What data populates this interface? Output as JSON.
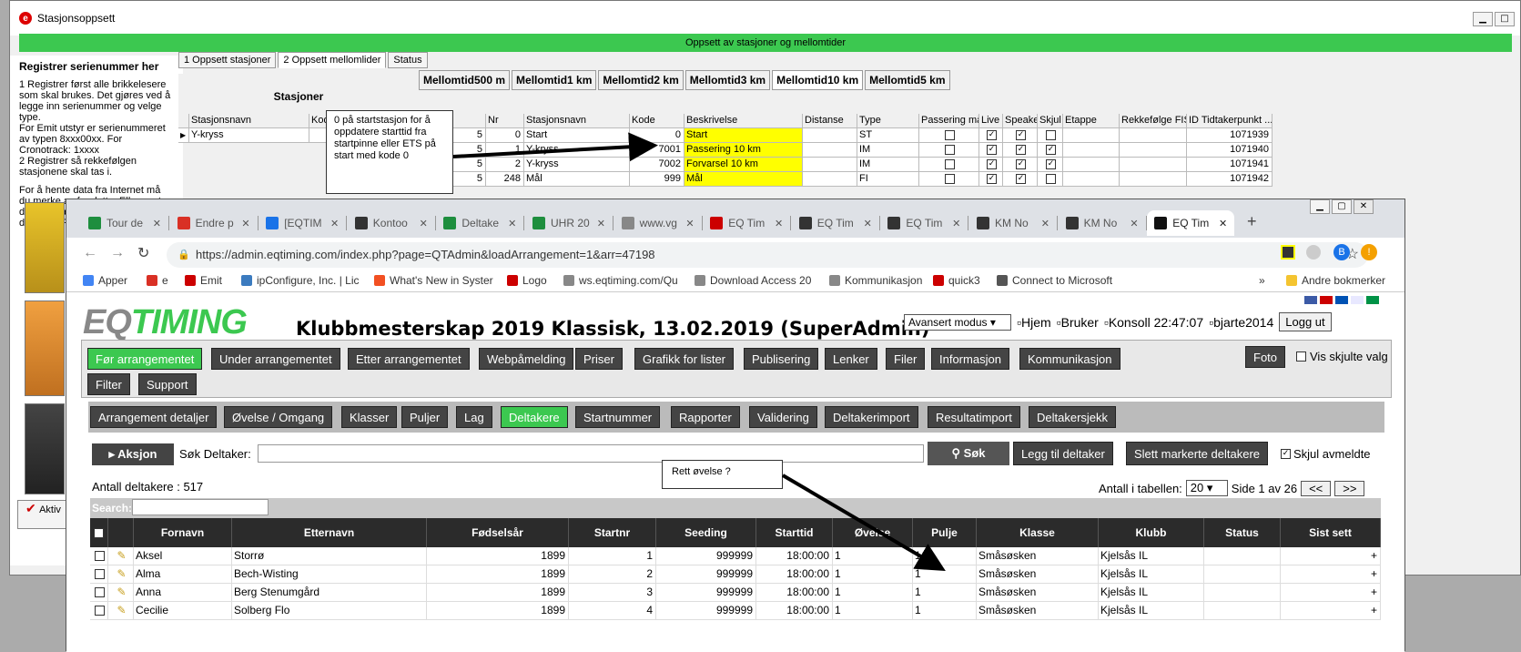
{
  "bg_window": {
    "title": "Stasjonsoppsett",
    "header": "Oppsett av stasjoner og mellomtider",
    "left_title": "Registrer serienummer her",
    "left_p1": "1 Registrer først alle brikkelesere som skal brukes. Det gjøres ved å legge inn serienummer og velge type.",
    "left_p2": "For Emit utstyr er serienummeret av typen 8xxx00xx. For Cronotrack: 1xxxx",
    "left_p3": "2 Registrer så rekkefølgen stasjonene skal tas i.",
    "left_p4": "For å hente data fra Internet må du merke av for dette. Ellers antas det at data kommer fra leser koblet direkte til PC-din.",
    "tabs": [
      "1 Oppsett stasjoner",
      "2 Oppsett mellomlider",
      "Status"
    ],
    "stasjoner_label": "Stasjoner",
    "left_cols": [
      "Stasjonsnavn",
      "Kod"
    ],
    "left_row": [
      "Y-kryss",
      ""
    ],
    "mellomtid_tabs": [
      "Mellomtid500 m",
      "Mellomtid1 km",
      "Mellomtid2 km",
      "Mellomtid3 km",
      "Mellomtid10 km",
      "Mellomtid5 km"
    ],
    "cols": [
      "e",
      "Nr",
      "Stasjonsnavn",
      "Kode",
      "Beskrivelse",
      "Distanse",
      "Type",
      "Passering mål",
      "Live",
      "Speaker",
      "Skjul",
      "Etappe",
      "Rekkefølge FIS",
      "ID Tidtakerpunkt ..."
    ],
    "rows": [
      {
        "e": "5",
        "nr": "0",
        "navn": "Start",
        "kode": "0",
        "besk": "Start",
        "type": "ST",
        "pass": "",
        "live": "✓",
        "speaker": "✓",
        "skjul": "",
        "id": "1071939"
      },
      {
        "e": "5",
        "nr": "1",
        "navn": "Y-kryss",
        "kode": "7001",
        "besk": "Passering 10 km",
        "type": "IM",
        "pass": "",
        "live": "✓",
        "speaker": "✓",
        "skjul": "✓",
        "id": "1071940"
      },
      {
        "e": "5",
        "nr": "2",
        "navn": "Y-kryss",
        "kode": "7002",
        "besk": "Forvarsel 10 km",
        "type": "IM",
        "pass": "",
        "live": "✓",
        "speaker": "✓",
        "skjul": "✓",
        "id": "1071941"
      },
      {
        "e": "5",
        "nr": "248",
        "navn": "Mål",
        "kode": "999",
        "besk": "Mål",
        "type": "FI",
        "pass": "",
        "live": "✓",
        "speaker": "✓",
        "skjul": "",
        "id": "1071942"
      }
    ],
    "aktiv_label": "Aktiv"
  },
  "callout1": "0 på startstasjon for å oppdatere starttid fra startpinne eller ETS på start med kode 0",
  "callout2": "Rett øvelse ?",
  "browser": {
    "tabs": [
      "Tour de",
      "Endre p",
      "[EQTIM",
      "Kontoo",
      "Deltake",
      "UHR 20",
      "www.vg",
      "EQ Tim",
      "EQ Tim",
      "EQ Tim",
      "KM No",
      "KM No",
      "EQ Tim"
    ],
    "url": "https://admin.eqtiming.com/index.php?page=QTAdmin&loadArrangement=1&arr=47198",
    "profile_initial": "B",
    "bookmarks": [
      "Apper",
      "e",
      "Emit",
      "ipConfigure, Inc. | Lic",
      "What's New in Syster",
      "Logo",
      "ws.eqtiming.com/Qu",
      "Download Access 20",
      "Kommunikasjon",
      "quick3",
      "Connect to Microsoft"
    ],
    "bookmarks_more": "»",
    "other_bookmarks": "Andre bokmerker"
  },
  "site": {
    "logo": "EQTIMING",
    "title": "Klubbmesterskap 2019 Klassisk, 13.02.2019 (SuperAdmin)",
    "mode": "Avansert modus",
    "hjem": "Hjem",
    "bruker": "Bruker",
    "konsoll": "Konsoll 22:47:07",
    "user": "bjarte2014",
    "logout": "Logg ut",
    "menu": [
      "Før arrangementet",
      "Under arrangementet",
      "Etter arrangementet",
      "Webpåmelding",
      "Priser",
      "Grafikk for lister",
      "Publisering",
      "Lenker",
      "Filer",
      "Informasjon",
      "Kommunikasjon"
    ],
    "menu2": [
      "Filter",
      "Support"
    ],
    "foto": "Foto",
    "vis_skjulte": "Vis skjulte valg",
    "submenu": [
      "Arrangement detaljer",
      "Øvelse / Omgang",
      "Klasser",
      "Puljer",
      "Lag",
      "Deltakere",
      "Startnummer",
      "Rapporter",
      "Validering",
      "Deltakerimport",
      "Resultatimport",
      "Deltakersjekk"
    ],
    "aksjon": "Aksjon",
    "sok_label": "Søk Deltaker:",
    "sok_btn": "Søk",
    "legg_til": "Legg til deltaker",
    "slett": "Slett markerte deltakere",
    "skjul_avmeldte": "Skjul avmeldte",
    "antall": "Antall deltakere : 517",
    "antall_tabell": "Antall i tabellen:",
    "per_page": "20",
    "side": "Side 1 av 26",
    "prev": "<<",
    "next": ">>",
    "search_label": "Search:",
    "cols": [
      "Fornavn",
      "Etternavn",
      "Fødselsår",
      "Startnr",
      "Seeding",
      "Starttid",
      "Øvelse",
      "Pulje",
      "Klasse",
      "Klubb",
      "Status",
      "Sist sett"
    ],
    "rows": [
      {
        "fornavn": "Aksel",
        "etternavn": "Storrø",
        "fodt": "1899",
        "startnr": "1",
        "seeding": "999999",
        "starttid": "18:00:00",
        "ovelse": "1",
        "pulje": "1",
        "klasse": "Småsøsken",
        "klubb": "Kjelsås IL",
        "status": "",
        "sist": "+"
      },
      {
        "fornavn": "Alma",
        "etternavn": "Bech-Wisting",
        "fodt": "1899",
        "startnr": "2",
        "seeding": "999999",
        "starttid": "18:00:00",
        "ovelse": "1",
        "pulje": "1",
        "klasse": "Småsøsken",
        "klubb": "Kjelsås IL",
        "status": "",
        "sist": "+"
      },
      {
        "fornavn": "Anna",
        "etternavn": "Berg Stenumgård",
        "fodt": "1899",
        "startnr": "3",
        "seeding": "999999",
        "starttid": "18:00:00",
        "ovelse": "1",
        "pulje": "1",
        "klasse": "Småsøsken",
        "klubb": "Kjelsås IL",
        "status": "",
        "sist": "+"
      },
      {
        "fornavn": "Cecilie",
        "etternavn": "Solberg Flo",
        "fodt": "1899",
        "startnr": "4",
        "seeding": "999999",
        "starttid": "18:00:00",
        "ovelse": "1",
        "pulje": "1",
        "klasse": "Småsøsken",
        "klubb": "Kjelsås IL",
        "status": "",
        "sist": "+"
      }
    ]
  }
}
